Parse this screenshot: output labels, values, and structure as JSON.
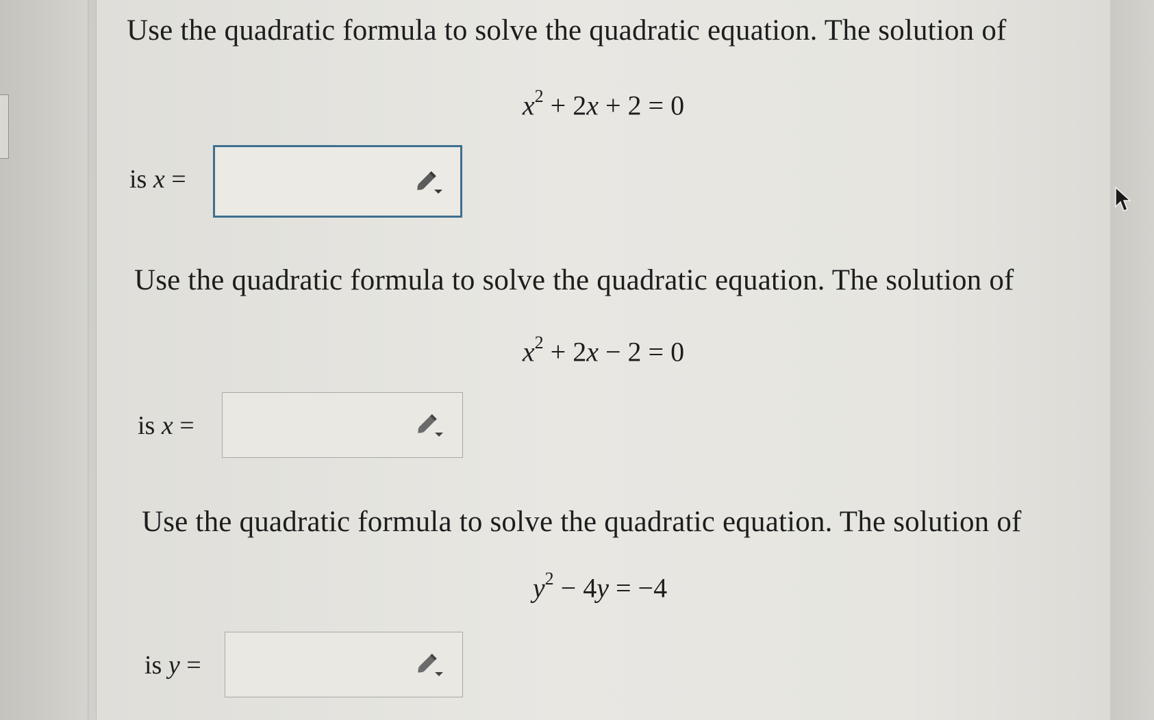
{
  "problems": [
    {
      "prompt": "Use the quadratic formula to solve the quadratic equation. The solution of",
      "equation": {
        "lhs_var": "x",
        "exponent": "2",
        "rest": " + 2",
        "rest_var": "x",
        "tail": " + 2 = 0"
      },
      "answer_prefix": "is ",
      "answer_var": "x",
      "answer_eq": " =",
      "answer_value": ""
    },
    {
      "prompt": "Use the quadratic formula to solve the quadratic equation. The solution of",
      "equation": {
        "lhs_var": "x",
        "exponent": "2",
        "rest": " + 2",
        "rest_var": "x",
        "tail": " − 2 = 0"
      },
      "answer_prefix": "is ",
      "answer_var": "x",
      "answer_eq": " =",
      "answer_value": ""
    },
    {
      "prompt": "Use the quadratic formula to solve the quadratic equation. The solution of",
      "equation": {
        "lhs_var": "y",
        "exponent": "2",
        "rest": " − 4",
        "rest_var": "y",
        "tail": " = −4"
      },
      "answer_prefix": "is ",
      "answer_var": "y",
      "answer_eq": " =",
      "answer_value": ""
    }
  ],
  "icons": {
    "editor": "pencil-dropdown-icon",
    "cursor": "mouse-pointer-icon"
  },
  "colors": {
    "focus_border": "#3d6f8e",
    "box_border": "#a9a8a4"
  }
}
